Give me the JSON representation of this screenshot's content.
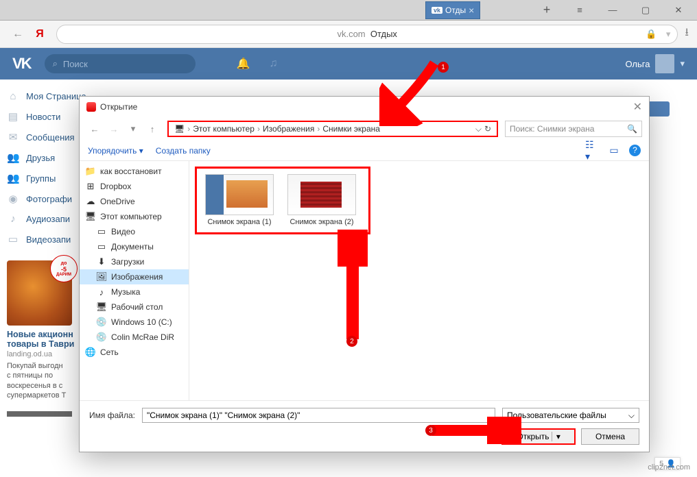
{
  "browser": {
    "tab_title": "Отды",
    "tab_prefix": "vk",
    "address_domain": "vk.com",
    "address_title": "Отдых"
  },
  "window_controls": {
    "new_tab": "+",
    "menu": "≡",
    "minimize": "—",
    "maximize": "▢",
    "close": "✕"
  },
  "vk": {
    "search_placeholder": "Поиск",
    "user_name": "Ольга",
    "nav": [
      {
        "icon": "⌂",
        "label": "Моя Страница"
      },
      {
        "icon": "▤",
        "label": "Новости"
      },
      {
        "icon": "✉",
        "label": "Сообщения"
      },
      {
        "icon": "👥",
        "label": "Друзья"
      },
      {
        "icon": "👥",
        "label": "Группы"
      },
      {
        "icon": "◉",
        "label": "Фотографи"
      },
      {
        "icon": "♪",
        "label": "Аудиозапи"
      },
      {
        "icon": "▭",
        "label": "Видеозапи"
      }
    ],
    "ad": {
      "badge_top": "до",
      "badge_pct": "-5",
      "badge_sub": "ДАРИМ",
      "title": "Новые акционн\nтовары в Таври",
      "domain": "landing.od.ua",
      "text": "Покупай выгодн\nс пятницы по\nвоскресенья в с\nсупермаркетов Т"
    }
  },
  "dialog": {
    "title": "Открытие",
    "breadcrumb": [
      "Этот компьютер",
      "Изображения",
      "Снимки экрана"
    ],
    "search_placeholder": "Поиск: Снимки экрана",
    "toolbar": {
      "organize": "Упорядочить",
      "new_folder": "Создать папку"
    },
    "tree": [
      {
        "icon": "📁",
        "label": "как восстановит",
        "cls": "fd-folder"
      },
      {
        "icon": "⊞",
        "label": "Dropbox",
        "cls": ""
      },
      {
        "icon": "☁",
        "label": "OneDrive",
        "cls": ""
      },
      {
        "icon": "🖥",
        "label": "Этот компьютер",
        "cls": ""
      },
      {
        "icon": "▭",
        "label": "Видео",
        "cls": "",
        "lvl": 1
      },
      {
        "icon": "▭",
        "label": "Документы",
        "cls": "",
        "lvl": 1
      },
      {
        "icon": "⬇",
        "label": "Загрузки",
        "cls": "",
        "lvl": 1
      },
      {
        "icon": "🖼",
        "label": "Изображения",
        "cls": "",
        "lvl": 1,
        "selected": true
      },
      {
        "icon": "♪",
        "label": "Музыка",
        "cls": "",
        "lvl": 1
      },
      {
        "icon": "🖥",
        "label": "Рабочий стол",
        "cls": "",
        "lvl": 1
      },
      {
        "icon": "💿",
        "label": "Windows 10 (C:)",
        "cls": "",
        "lvl": 1
      },
      {
        "icon": "💿",
        "label": "Colin McRae DiR",
        "cls": "",
        "lvl": 1
      },
      {
        "icon": "🌐",
        "label": "Сеть",
        "cls": ""
      }
    ],
    "files": [
      {
        "label": "Снимок экрана (1)"
      },
      {
        "label": "Снимок экрана (2)"
      }
    ],
    "filename_label": "Имя файла:",
    "filename_value": "\"Снимок экрана (1)\" \"Снимок экрана (2)\"",
    "filetype": "Пользовательские файлы",
    "open": "Открыть",
    "cancel": "Отмена"
  },
  "annotations": {
    "a1": "1",
    "a2": "2",
    "a3": "3"
  },
  "footer": {
    "clip": "clip2net.com",
    "people": "5"
  }
}
